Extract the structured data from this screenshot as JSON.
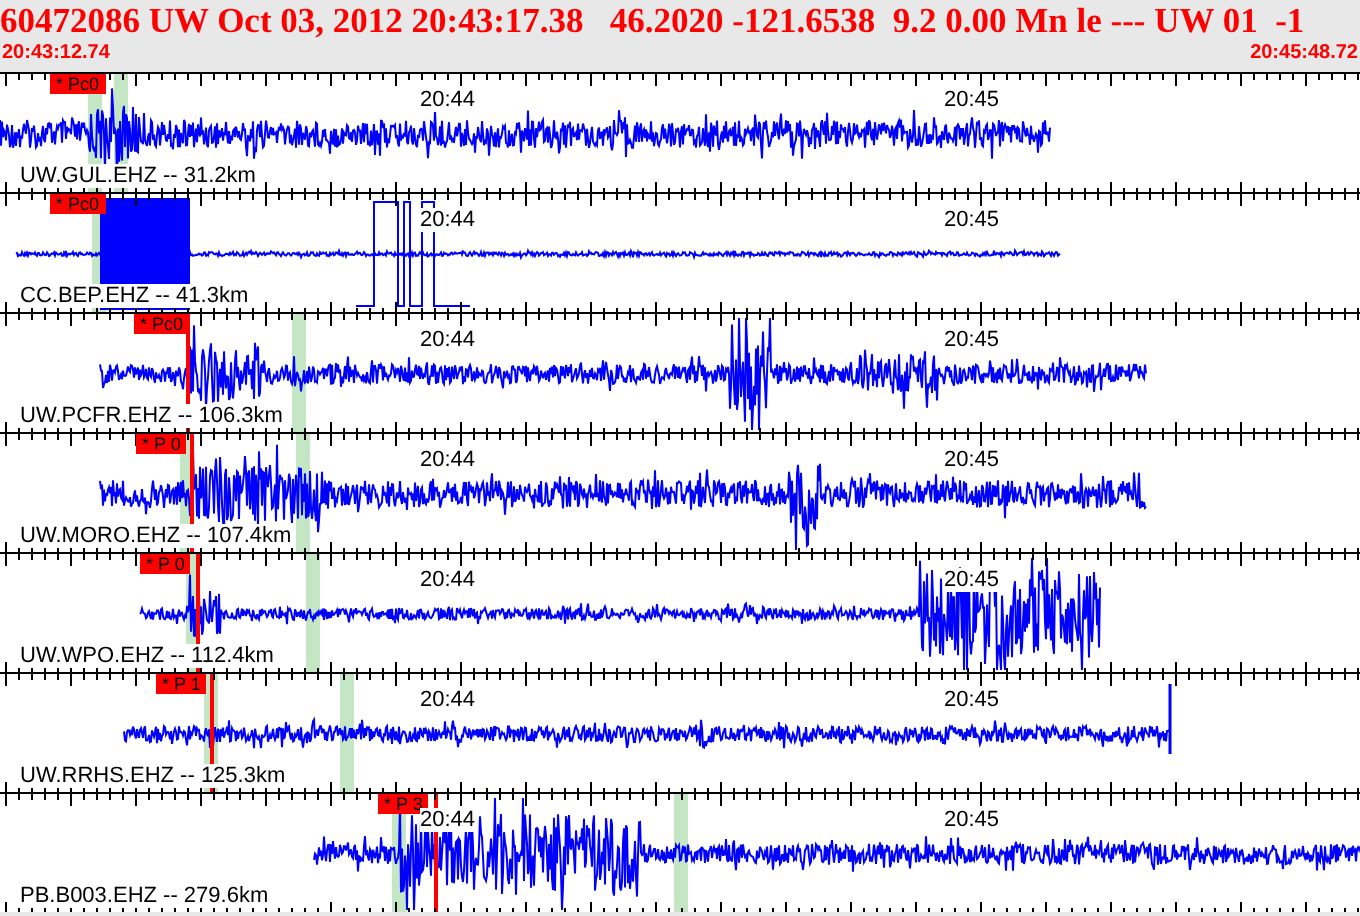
{
  "header": {
    "title": "60472086 UW Oct 03, 2012 20:43:17.38   46.2020 -121.6538  9.2 0.00 Mn le --- UW 01  -1",
    "start_time": "20:43:12.74",
    "end_time": "20:45:48.72"
  },
  "traces": [
    {
      "station": "UW.GUL.EHZ -- 31.2km",
      "pick": "* Pc0",
      "time_labels": [
        "20:44",
        "20:45"
      ]
    },
    {
      "station": "CC.BEP.EHZ -- 41.3km",
      "pick": "* Pc0",
      "time_labels": [
        "20:44",
        "20:45"
      ]
    },
    {
      "station": "UW.PCFR.EHZ -- 106.3km",
      "pick": "* Pc0",
      "time_labels": [
        "20:44",
        "20:45"
      ]
    },
    {
      "station": "UW.MORO.EHZ -- 107.4km",
      "pick": "* P 0",
      "time_labels": [
        "20:44",
        "20:45"
      ]
    },
    {
      "station": "UW.WPO.EHZ -- 112.4km",
      "pick": "* P 0",
      "time_labels": [
        "20:44",
        "20:45"
      ]
    },
    {
      "station": "UW.RRHS.EHZ -- 125.3km",
      "pick": "* P 1",
      "time_labels": [
        "20:44",
        "20:45"
      ]
    },
    {
      "station": "PB.B003.EHZ -- 279.6km",
      "pick": "* P 3",
      "time_labels": [
        "20:44",
        "20:45"
      ]
    }
  ]
}
